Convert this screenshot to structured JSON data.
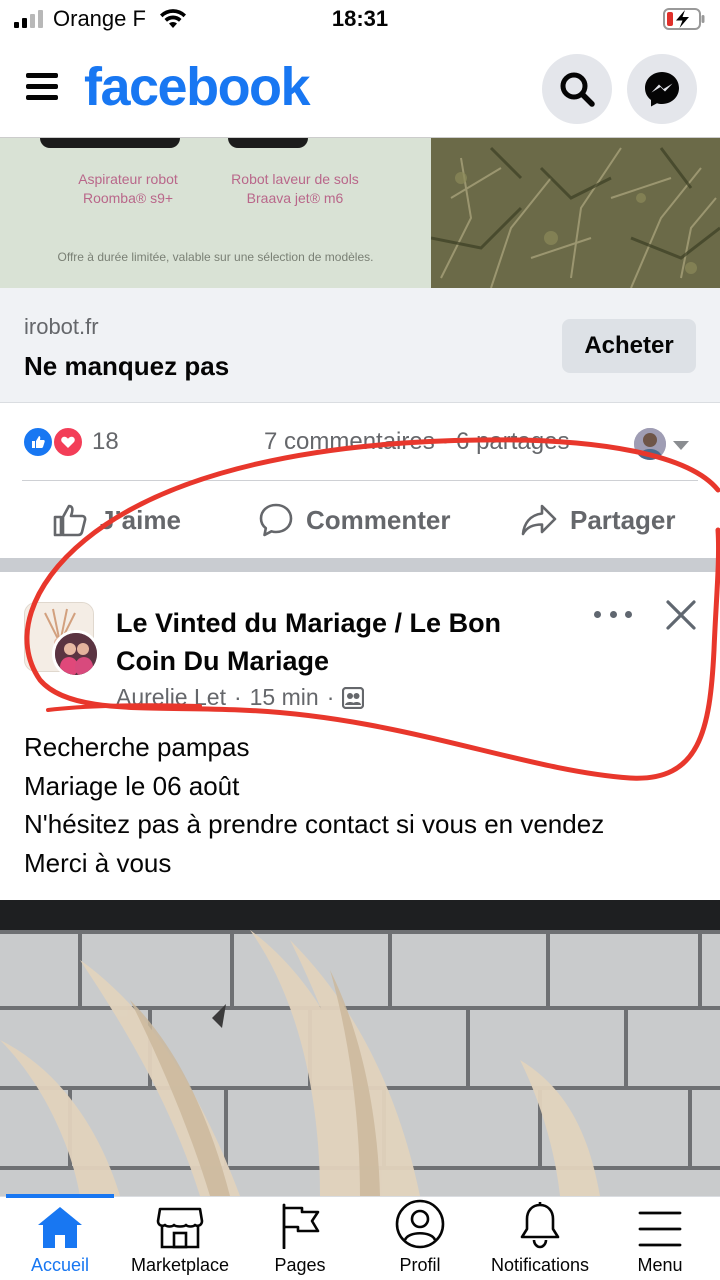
{
  "status_bar": {
    "carrier": "Orange F",
    "time": "18:31"
  },
  "header": {
    "brand": "facebook",
    "brand_color": "#1877f2",
    "icons": [
      "hamburger-icon",
      "search-icon",
      "messenger-icon"
    ]
  },
  "ad": {
    "product_1": "Aspirateur robot\nRoomba® s9+",
    "product_2": "Robot laveur de sols\nBraava jet® m6",
    "offer": "Offre à durée limitée, valable sur une sélection de modèles.",
    "domain": "irobot.fr",
    "headline": "Ne manquez pas",
    "cta": "Acheter"
  },
  "reactions": {
    "count": "18",
    "comments_shares": "7 commentaires · 6 partages",
    "types": [
      "like",
      "love"
    ]
  },
  "actions": {
    "like": "J’aime",
    "comment": "Commenter",
    "share": "Partager"
  },
  "post": {
    "group_name": "Le Vinted du Mariage / Le Bon Coin Du Mariage",
    "author": "Aurelie Let",
    "time": "15 min",
    "body_lines": [
      "Recherche pampas",
      "Mariage le 06 août",
      "N'hésitez pas à prendre contact si vous en vendez",
      "Merci à vous"
    ]
  },
  "tabs": [
    {
      "label": "Accueil",
      "icon": "home-icon",
      "active": true
    },
    {
      "label": "Marketplace",
      "icon": "marketplace-icon",
      "active": false
    },
    {
      "label": "Pages",
      "icon": "flag-icon",
      "active": false
    },
    {
      "label": "Profil",
      "icon": "profile-icon",
      "active": false
    },
    {
      "label": "Notifications",
      "icon": "bell-icon",
      "active": false
    },
    {
      "label": "Menu",
      "icon": "menu-icon",
      "active": false
    }
  ],
  "colors": {
    "annotation": "#e8372c",
    "like_blue": "#1877f2",
    "love_red": "#f33e58",
    "secondary_text": "#65676b"
  }
}
